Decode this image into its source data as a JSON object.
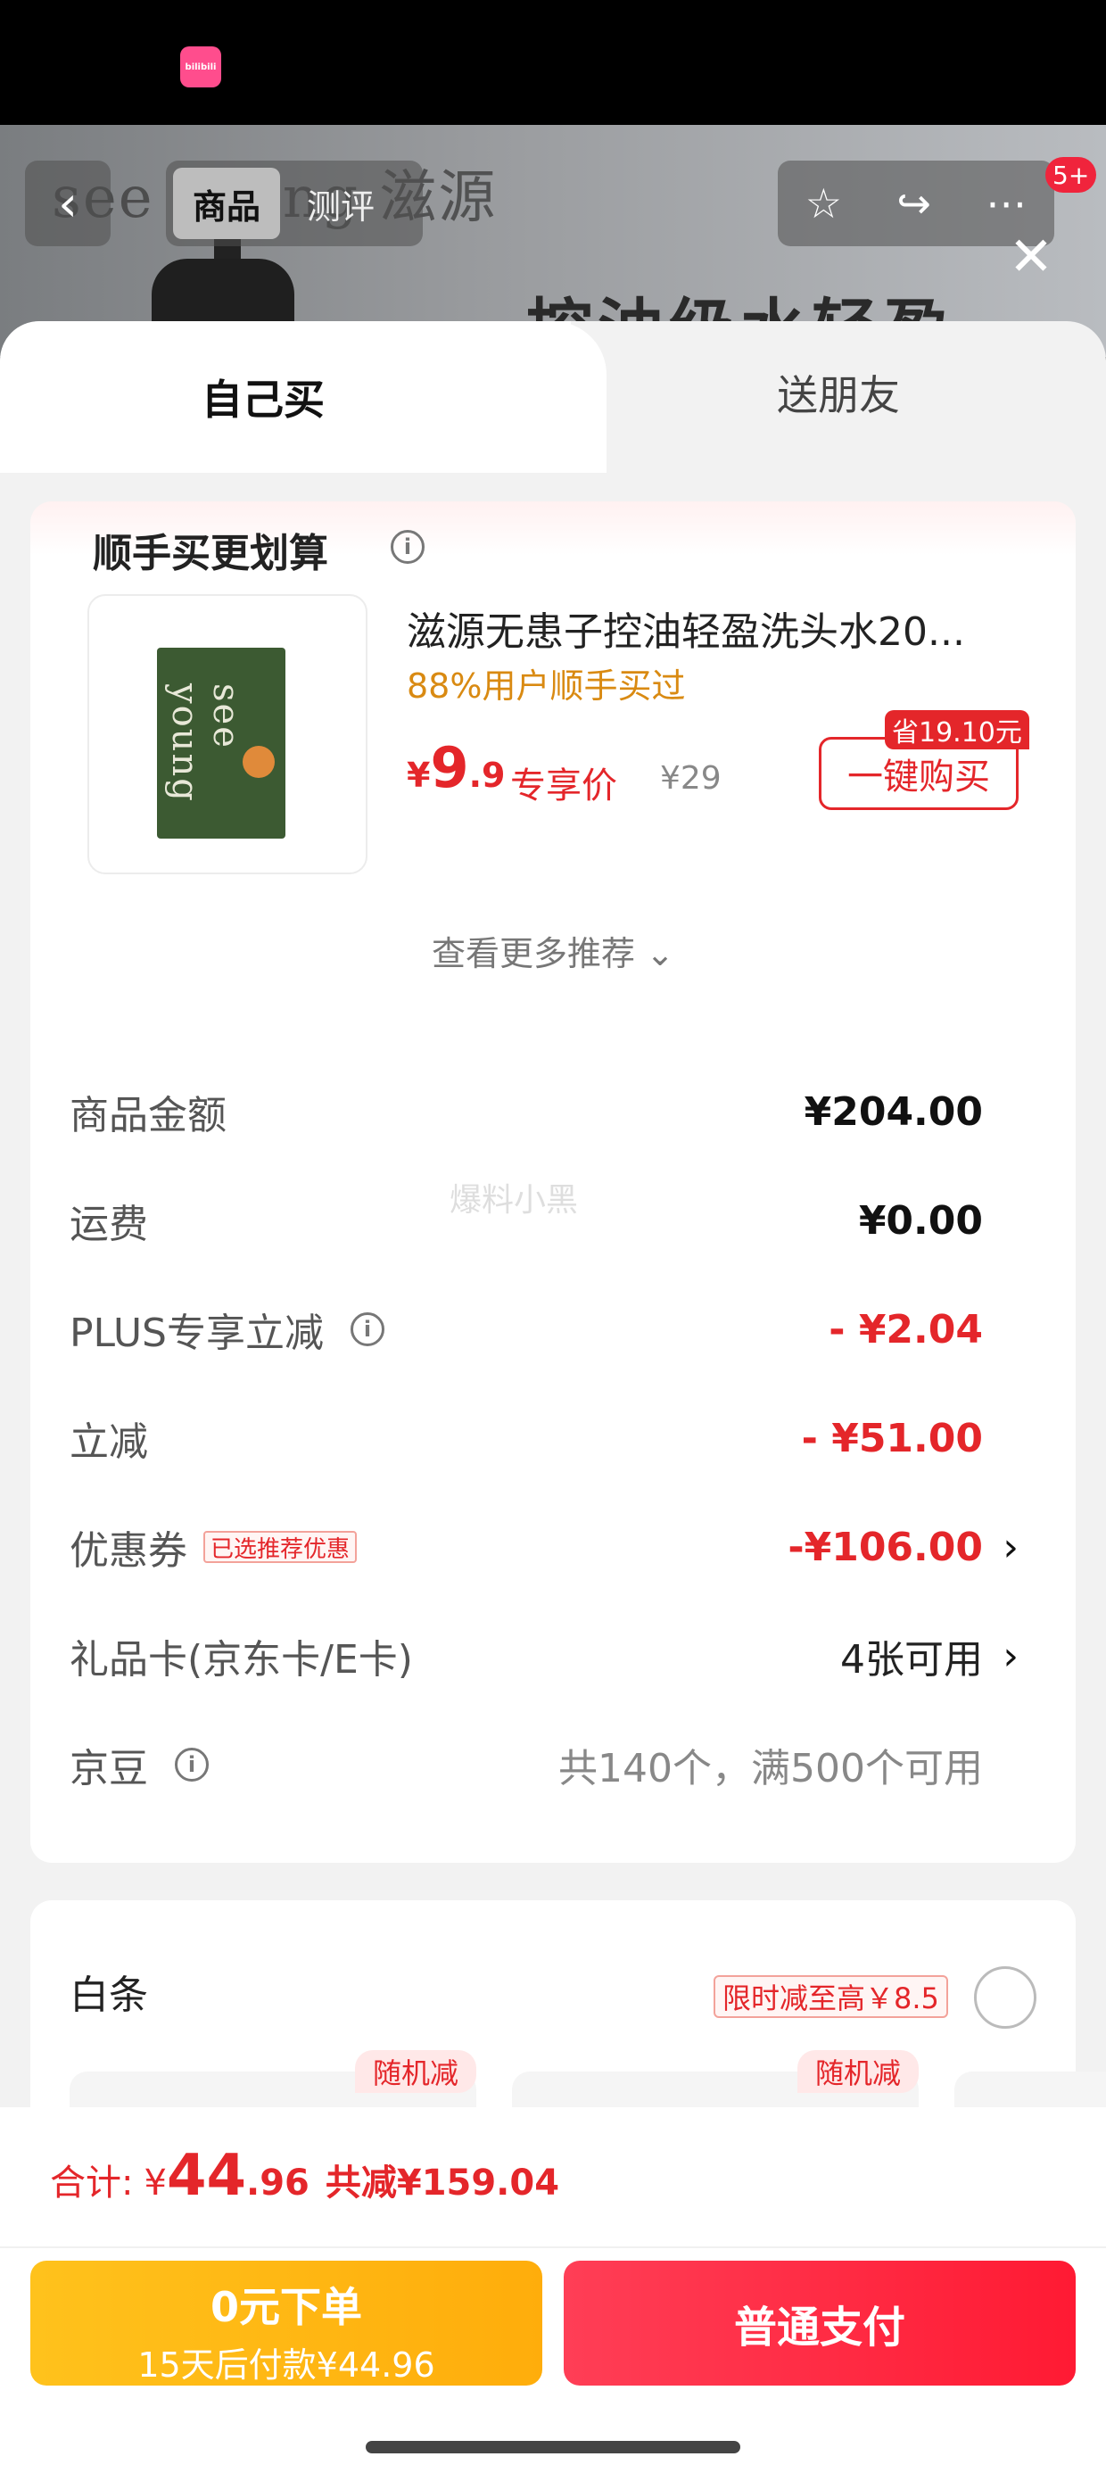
{
  "status_bar": {
    "app_badge": "bilibili"
  },
  "background": {
    "brand": "see young 滋源",
    "headline": "控油级水轻盈"
  },
  "nav": {
    "back_glyph": "‹",
    "tabs": [
      {
        "label": "商品"
      },
      {
        "label": "测评"
      }
    ],
    "message_badge": "5+",
    "close_glyph": "✕"
  },
  "sheet_tabs": {
    "self": "自己买",
    "friend": "送朋友"
  },
  "add_on": {
    "title": "顺手买更划算",
    "product_name": "滋源无患子控油轻盈洗头水20...",
    "sachet_text": "see young",
    "bought_ratio": "88%用户顺手买过",
    "price_symbol": "¥",
    "price_int": "9",
    "price_dec": ".9",
    "price_label": "专享价",
    "original_price": "¥29",
    "save_tag": "省19.10元",
    "buy_button": "一键购买",
    "more_recommend": "查看更多推荐 ⌄"
  },
  "summary": {
    "watermark": "爆料小黑",
    "rows": [
      {
        "label": "商品金额",
        "value": "¥204.00"
      },
      {
        "label": "运费",
        "value": "¥0.00"
      },
      {
        "label": "PLUS专享立减",
        "value": "- ¥2.04"
      },
      {
        "label": "立减",
        "value": "- ¥51.00"
      },
      {
        "label": "优惠券",
        "tag": "已选推荐优惠",
        "value": "-¥106.00"
      },
      {
        "label": "礼品卡(京东卡/E卡)",
        "value": "4张可用"
      },
      {
        "label": "京豆",
        "value": "共140个，满500个可用"
      }
    ]
  },
  "baitiao": {
    "label": "白条",
    "promo": "限时减至高￥8.5",
    "plan_tag": "随机减"
  },
  "footer": {
    "total_label": "合计:",
    "total_symbol": "¥",
    "total_int": "44",
    "total_dec": ".96",
    "total_saved": "共减¥159.04",
    "zero_pay_title": "0元下单",
    "zero_pay_sub": "15天后付款¥44.96",
    "pay_button": "普通支付"
  },
  "colors": {
    "accent_red": "#e4262a",
    "orange": "#d98a12",
    "yellow_button": "#ffb812",
    "pay_button": "#ff2a42"
  }
}
